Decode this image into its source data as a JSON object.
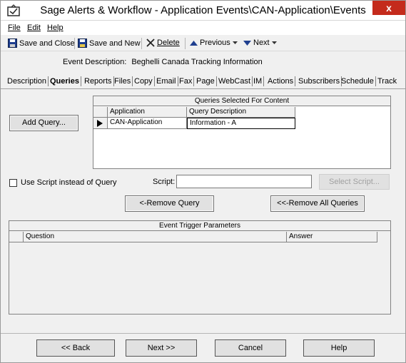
{
  "window": {
    "title": "Sage Alerts & Workflow - Application Events\\CAN-Application\\Events",
    "close_glyph": "x"
  },
  "menu": {
    "file": "File",
    "edit": "Edit",
    "help": "Help"
  },
  "toolbar": {
    "save_close": "Save and Close",
    "save_new": "Save and New",
    "delete": "Delete",
    "previous": "Previous",
    "next": "Next"
  },
  "event_description": {
    "label": "Event Description:",
    "value": "Beghelli Canada Tracking Information"
  },
  "tabs": [
    "Description",
    "Queries",
    "Reports",
    "Files",
    "Copy",
    "Email",
    "Fax",
    "Page",
    "WebCast",
    "IM",
    "Actions",
    "Subscribers",
    "Schedule",
    "Track"
  ],
  "active_tab": "Queries",
  "queries": {
    "add_query": "Add Query...",
    "grid_caption": "Queries Selected For Content",
    "columns": [
      "Application",
      "Query Description"
    ],
    "rows": [
      {
        "application": "CAN-Application",
        "description": "Information - A"
      }
    ]
  },
  "script": {
    "use_script_label": "Use Script instead of Query",
    "use_script_checked": false,
    "script_label": "Script:",
    "script_value": "",
    "select_script": "Select Script...",
    "remove_query": "<-Remove Query",
    "remove_all": "<<-Remove All Queries"
  },
  "trigger": {
    "caption": "Event Trigger Parameters",
    "columns": [
      "Question",
      "Answer"
    ]
  },
  "footer": {
    "back": "<< Back",
    "next": "Next >>",
    "cancel": "Cancel",
    "help": "Help"
  },
  "colors": {
    "close_button": "#c42b1c",
    "window_bg": "#f0f0f0"
  },
  "icons": {
    "app": "sage-app-icon",
    "save_close": "floppy-icon",
    "save_new": "floppy-icon",
    "delete": "x-icon",
    "previous": "up-arrow-icon",
    "next": "down-arrow-icon",
    "row_pointer": "triangle-right-icon"
  }
}
